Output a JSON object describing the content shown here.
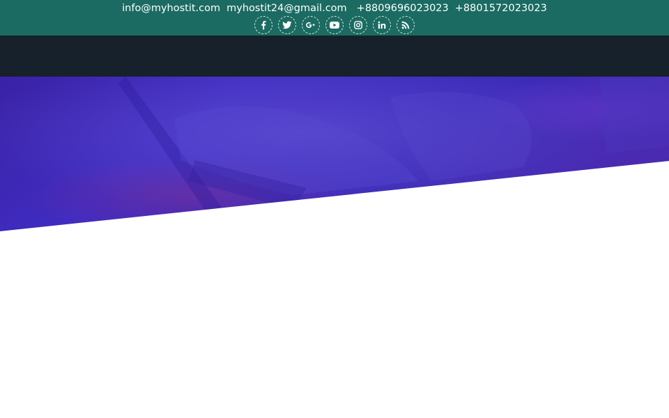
{
  "topbar": {
    "contacts": {
      "email_primary": "info@myhostit.com",
      "email_secondary": "myhostit24@gmail.com",
      "phone_primary": "+8809696023023",
      "phone_secondary": "+8801572023023"
    },
    "social_links": [
      {
        "icon": "facebook-icon"
      },
      {
        "icon": "twitter-icon"
      },
      {
        "icon": "google-plus-icon"
      },
      {
        "icon": "youtube-icon"
      },
      {
        "icon": "instagram-icon"
      },
      {
        "icon": "linkedin-icon"
      },
      {
        "icon": "rss-icon"
      }
    ]
  },
  "colors": {
    "topbar_bg": "#1b6b62",
    "navbar_bg": "#17212b",
    "hero_overlay": "#3a26b8",
    "page_bg": "#ffffff"
  }
}
